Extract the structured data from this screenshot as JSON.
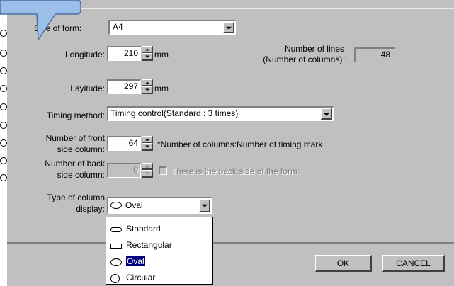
{
  "form": {
    "size_label": "Size of form:",
    "size_value": "A4",
    "longitude_label": "Longitude:",
    "longitude_value": "210",
    "longitude_unit": "mm",
    "layitude_label": "Layitude:",
    "layitude_value": "297",
    "layitude_unit": "mm",
    "lines_label_1": "Number of lines",
    "lines_label_2": "(Number of columns) :",
    "lines_value": "48",
    "timing_label": "Timing method:",
    "timing_value": "Timing control(Standard : 3 times)",
    "front_label_1": "Number of front",
    "front_label_2": "side column:",
    "front_value": "64",
    "front_note": "*Number of columns:Number of timing mark",
    "back_label_1": "Number of back",
    "back_label_2": "side column:",
    "back_value": "0",
    "back_checkbox_label": "There is the back side of the form.",
    "type_label_1": "Type of column",
    "type_label_2": "display:",
    "type_value": "Oval"
  },
  "dropdown": {
    "options": [
      "Standard",
      "Rectangular",
      "Oval",
      "Circular"
    ],
    "selected": "Oval"
  },
  "buttons": {
    "ok": "OK",
    "cancel": "CANCEL"
  },
  "colors": {
    "dialog_bg": "#c0c0c0",
    "callout_fill": "#9bbfe8",
    "selection": "#000080"
  }
}
